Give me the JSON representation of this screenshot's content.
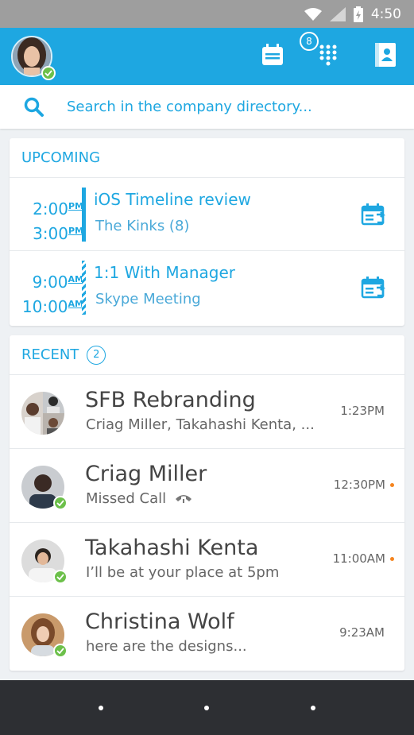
{
  "status_bar": {
    "time": "4:50",
    "icons": [
      "wifi-icon",
      "signal-icon",
      "battery-icon"
    ]
  },
  "header": {
    "dialpad_badge": "8",
    "icons": [
      "calendar-icon",
      "dialpad-icon",
      "contacts-icon"
    ],
    "accent_color": "#1ea7e1"
  },
  "search": {
    "placeholder": "Search in the company directory..."
  },
  "upcoming": {
    "title": "UPCOMING",
    "meetings": [
      {
        "start": "2:00",
        "start_ampm": "PM",
        "end": "3:00",
        "end_ampm": "PM",
        "title": "iOS Timeline review",
        "subtitle": "The Kinks (8)"
      },
      {
        "start": "9:00",
        "start_ampm": "AM",
        "end": "10:00",
        "end_ampm": "AM",
        "title": "1:1 With Manager",
        "subtitle": "Skype Meeting"
      }
    ]
  },
  "recent": {
    "title": "RECENT",
    "count": "2",
    "items": [
      {
        "name": "SFB Rebranding",
        "snippet": "Criag Miller, Takahashi Kenta, ...",
        "time": "1:23PM",
        "unread": false
      },
      {
        "name": "Criag Miller",
        "snippet": "Missed Call",
        "time": "12:30PM",
        "unread": true
      },
      {
        "name": "Takahashi Kenta",
        "snippet": "I’ll be at your place at 5pm",
        "time": "11:00AM",
        "unread": true
      },
      {
        "name": "Christina Wolf",
        "snippet": "here are the designs...",
        "time": "9:23AM",
        "unread": false
      }
    ]
  },
  "colors": {
    "presence_available": "#6cc04a",
    "unread_dot": "#f5841f"
  }
}
